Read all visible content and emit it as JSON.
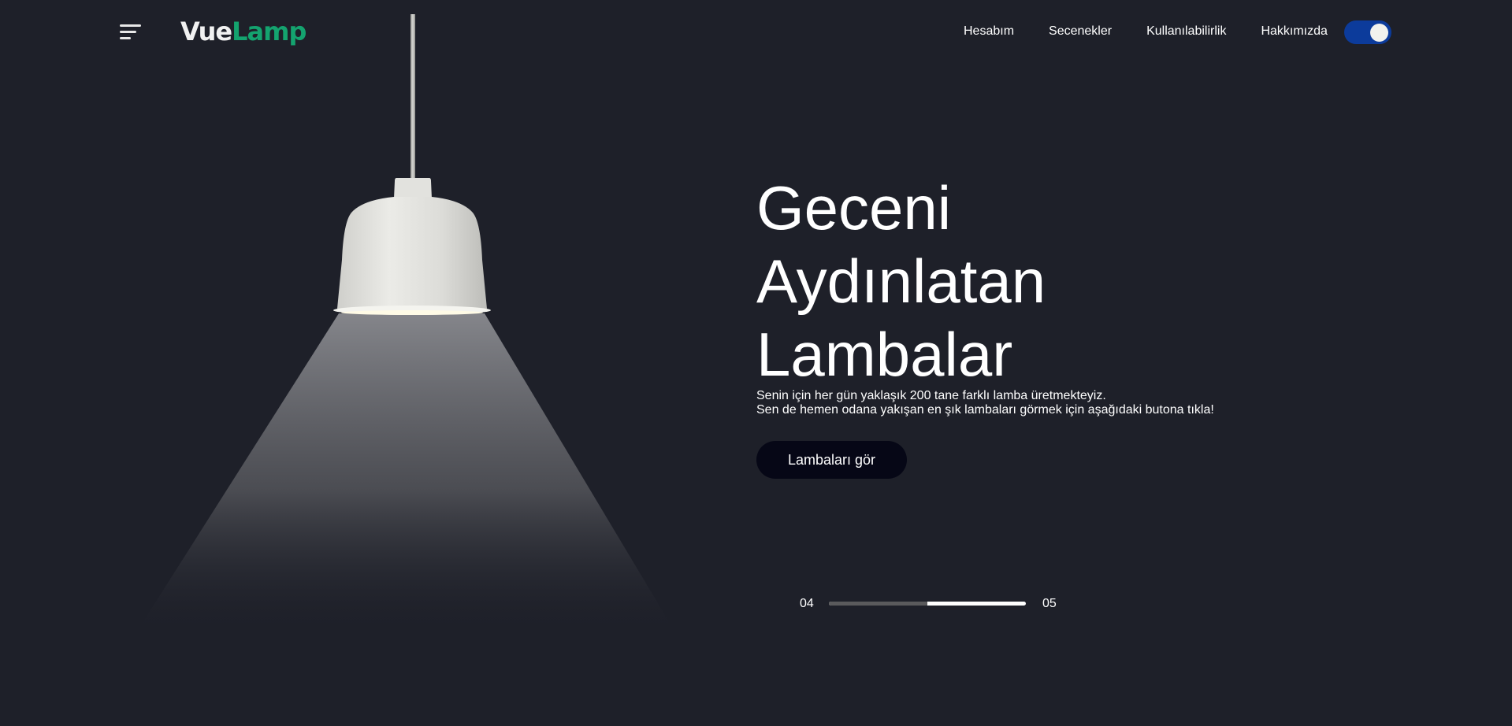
{
  "header": {
    "logo": {
      "part1": "Vue",
      "part2": "Lamp"
    },
    "nav": [
      "Hesabım",
      "Secenekler",
      "Kullanılabilirlik",
      "Hakkımızda"
    ],
    "theme_toggle": {
      "on": true
    }
  },
  "hero": {
    "title_lines": [
      "Geceni",
      "Aydınlatan",
      "Lambalar"
    ],
    "subtitle_lines": [
      "Senin için her gün yaklaşık 200 tane farklı lamba üretmekteyiz.",
      "Sen de hemen odana yakışan en şık lambaları görmek için aşağıdaki butona tıkla!"
    ],
    "cta_label": "Lambaları gör"
  },
  "pager": {
    "current": "04",
    "total": "05",
    "progress_fraction": 0.5
  },
  "colors": {
    "background": "#1e2029",
    "logo_accent": "#14a36f",
    "toggle": "#0c3b9b",
    "button": "#060716"
  },
  "icons": {
    "menu": "hamburger-icon",
    "lamp": "pendant-lamp-illustration"
  }
}
